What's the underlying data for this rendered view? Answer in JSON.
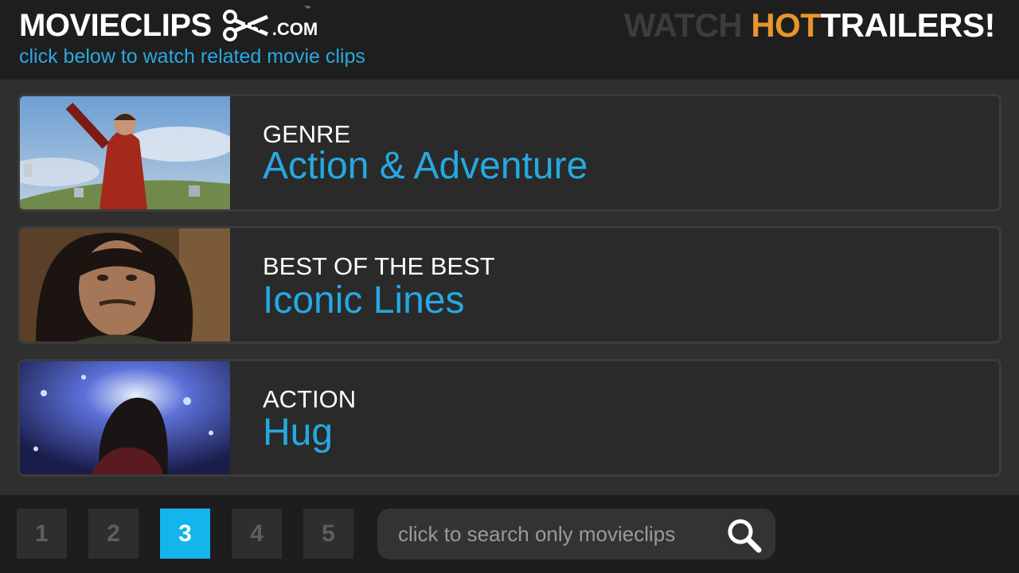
{
  "header": {
    "logo_text": "MOVIECLIPS",
    "logo_tm": "™",
    "logo_domain": ".COM",
    "tagline": "click below to watch related movie clips",
    "promo": {
      "part1": "WATCH ",
      "part2": "HOT",
      "part3": "TRAILERS!"
    }
  },
  "cards": [
    {
      "category": "GENRE",
      "title": "Action & Adventure",
      "thumbnail": "broom-rider-scene"
    },
    {
      "category": "BEST OF THE BEST",
      "title": "Iconic Lines",
      "thumbnail": "swordsman-closeup"
    },
    {
      "category": "ACTION",
      "title": "Hug",
      "thumbnail": "alien-silhouette-light"
    }
  ],
  "pagination": {
    "pages": [
      "1",
      "2",
      "3",
      "4",
      "5"
    ],
    "active": "3"
  },
  "search": {
    "placeholder": "click to search only movieclips",
    "icon": "search-icon"
  },
  "colors": {
    "accent_blue": "#25a9e0",
    "promo_orange": "#e8952a",
    "active_page": "#13b5ec"
  }
}
